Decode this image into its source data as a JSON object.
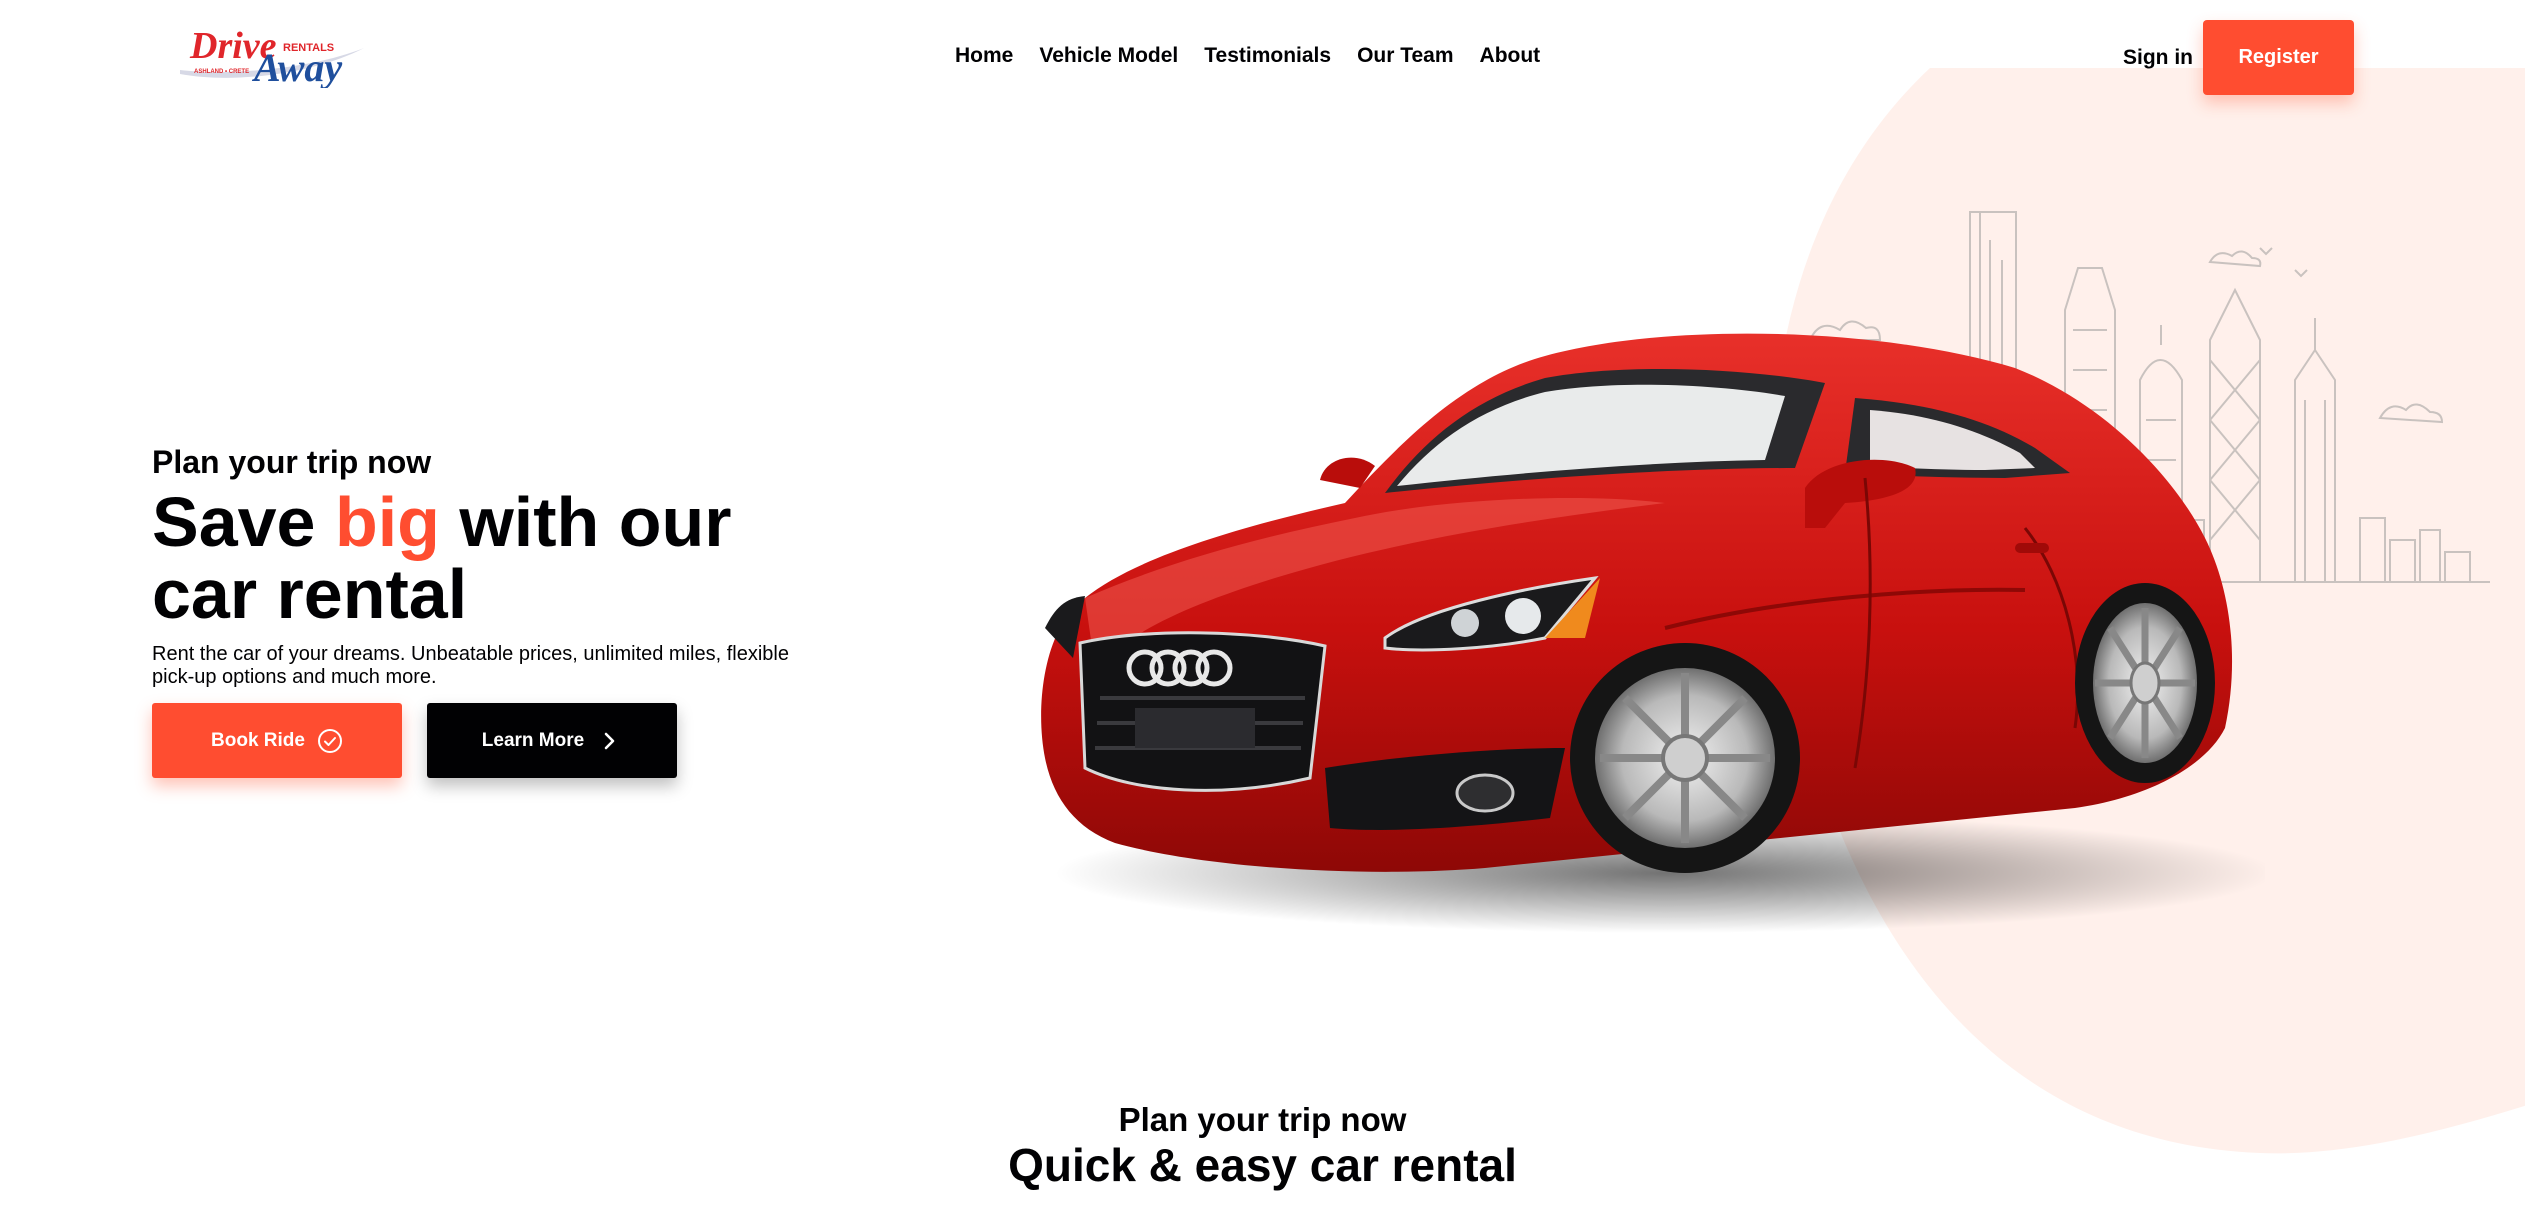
{
  "brand": {
    "logo_word_1": "Drive",
    "logo_word_2": "Away",
    "logo_tag": "RENTALS",
    "logo_small": "ASHLAND • CRETE",
    "accent_color": "#ff4d30",
    "blob_color": "#fff0eb"
  },
  "nav": {
    "items": [
      "Home",
      "Vehicle Model",
      "Testimonials",
      "Our Team",
      "About"
    ]
  },
  "auth": {
    "signin_label": "Sign in",
    "register_label": "Register"
  },
  "hero": {
    "subtitle": "Plan your trip now",
    "title_part1": "Save ",
    "title_accent": "big",
    "title_part2": " with our car rental",
    "description": "Rent the car of your dreams. Unbeatable prices, unlimited miles, flexible pick-up options and much more.",
    "book_label": "Book Ride",
    "book_icon": "check-circle-icon",
    "learn_label": "Learn More",
    "learn_icon": "chevron-right-icon",
    "car_color": "#c8100e"
  },
  "section": {
    "subtitle": "Plan your trip now",
    "title": "Quick & easy car rental"
  }
}
